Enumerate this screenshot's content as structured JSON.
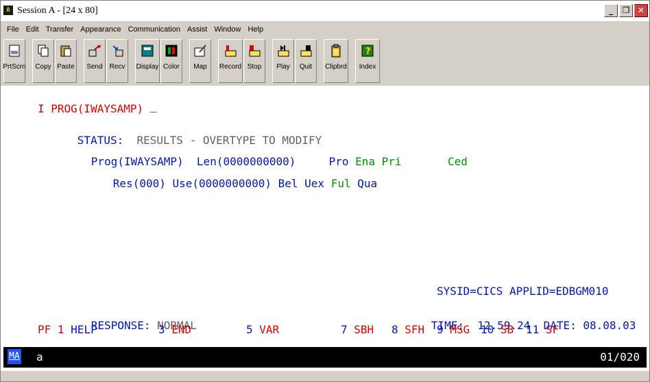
{
  "window": {
    "title": "Session A - [24 x 80]",
    "title_icon": "ñ¹",
    "buttons": [
      "_",
      "▫",
      "X"
    ]
  },
  "menu": [
    "File",
    "Edit",
    "Transfer",
    "Appearance",
    "Communication",
    "Assist",
    "Window",
    "Help"
  ],
  "toolbar": [
    {
      "label": "PrtScrn",
      "icon": "printer-icon"
    },
    {
      "label": "Copy",
      "icon": "copy-icon"
    },
    {
      "label": "Paste",
      "icon": "paste-icon"
    },
    {
      "label": "Send",
      "icon": "send-icon"
    },
    {
      "label": "Recv",
      "icon": "receive-icon"
    },
    {
      "label": "Display",
      "icon": "display-icon"
    },
    {
      "label": "Color",
      "icon": "color-icon"
    },
    {
      "label": "Map",
      "icon": "map-icon"
    },
    {
      "label": "Record",
      "icon": "record-icon"
    },
    {
      "label": "Stop",
      "icon": "stop-icon"
    },
    {
      "label": "Play",
      "icon": "play-icon"
    },
    {
      "label": "Quit",
      "icon": "quit-icon"
    },
    {
      "label": "Clipbrd",
      "icon": "clipboard-icon"
    },
    {
      "label": "Index",
      "icon": "help-index-icon"
    }
  ],
  "terminal": {
    "command": "I PROG(IWAYSAMP)",
    "status_label": "STATUS:",
    "status_text": "RESULTS - OVERTYPE TO MODIFY",
    "prog_blue": "Prog(IWAYSAMP)  Len(0000000000)     Pro",
    "ena_pri": "Ena Pri",
    "ced": "Ced",
    "res_blue": "Res(000) Use(0000000000) Bel Uex",
    "ful": "Ful",
    "qua": "Qua",
    "sysid": "SYSID=CICS APPLID=EDBGM010",
    "response_label": "RESPONSE:",
    "response_value": "NORMAL",
    "time_label": "TIME:",
    "time_value": "12.59.24",
    "date_label": "DATE:",
    "date_value": "08.08.03",
    "pf_keys": [
      {
        "num": "PF 1",
        "name": "HELP"
      },
      {
        "num": "3",
        "name": "END"
      },
      {
        "num": "5",
        "name": "VAR"
      },
      {
        "num": "7",
        "name": "SBH"
      },
      {
        "num": "8",
        "name": "SFH"
      },
      {
        "num": "9",
        "name": "MSG"
      },
      {
        "num": "10",
        "name": "SB"
      },
      {
        "num": "11",
        "name": "SF"
      }
    ]
  },
  "statusbar": {
    "mode": "MA",
    "input": "a",
    "cursor_pos": "01/020"
  }
}
